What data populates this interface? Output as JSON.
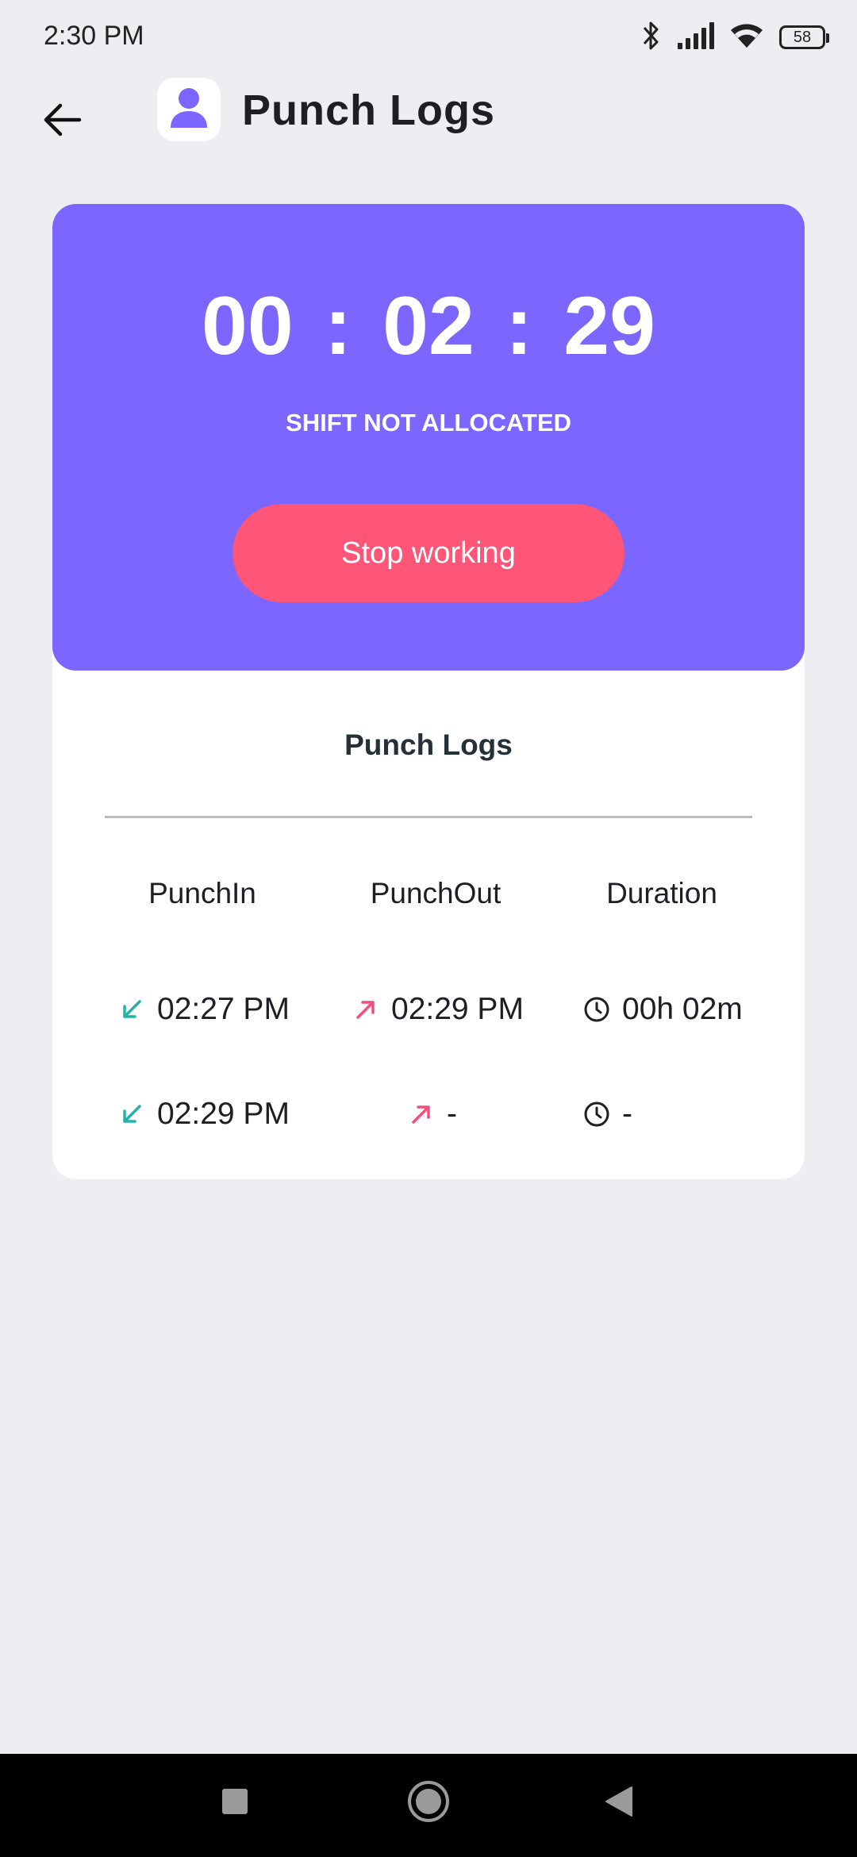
{
  "status_bar": {
    "time": "2:30 PM",
    "battery": "58",
    "icons": [
      "bluetooth-icon",
      "signal-icon",
      "wifi-icon",
      "battery-icon"
    ]
  },
  "header": {
    "title": "Punch Logs",
    "back_icon": "arrow-left-icon",
    "avatar_icon": "person-icon"
  },
  "timer_card": {
    "timer": "00 : 02 : 29",
    "shift_status": "SHIFT NOT ALLOCATED",
    "stop_label": "Stop working"
  },
  "logs": {
    "title": "Punch Logs",
    "columns": [
      "PunchIn",
      "PunchOut",
      "Duration"
    ],
    "rows": [
      {
        "punch_in": "02:27 PM",
        "punch_out": "02:29 PM",
        "duration": "00h 02m"
      },
      {
        "punch_in": "02:29 PM",
        "punch_out": "-",
        "duration": "-"
      }
    ]
  },
  "colors": {
    "accent": "#7b66ff",
    "stop": "#ff5577",
    "punch_in_icon": "#1fb5a9",
    "punch_out_icon": "#f0507a",
    "background": "#eeedf2"
  }
}
